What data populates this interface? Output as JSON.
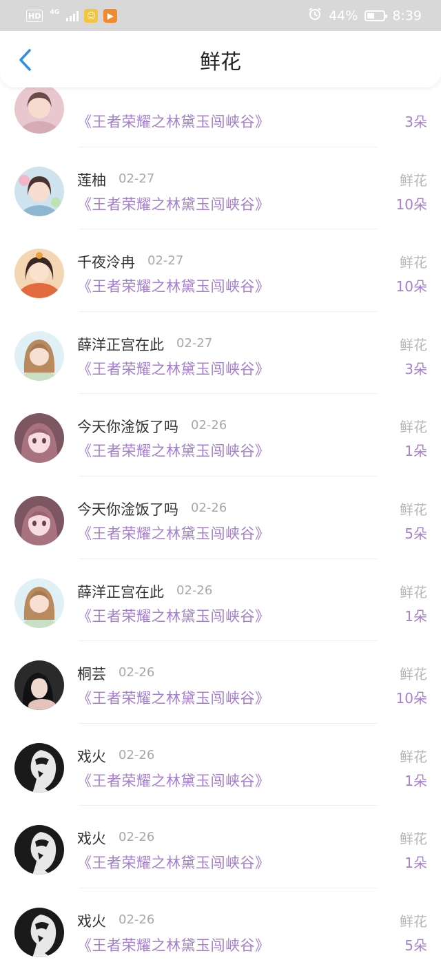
{
  "status_bar": {
    "hd": "HD",
    "network": "4G",
    "battery_percent": "44%",
    "battery_level": 0.44,
    "time": "8:39",
    "icons": [
      "hd-icon",
      "signal-4g-icon",
      "app-notification-icon",
      "video-app-icon",
      "alarm-icon",
      "battery-icon"
    ]
  },
  "header": {
    "title": "鲜花",
    "back_icon": "chevron-left-icon"
  },
  "colors": {
    "accent": "#a57ed0",
    "back": "#2f8fe8",
    "status_bar": "#d8d8d8"
  },
  "rows": [
    {
      "name": "",
      "date": "",
      "book": "《王者荣耀之林黛玉闯峡谷》",
      "gift": "",
      "count": "3朵",
      "avatar": "portrait-pink"
    },
    {
      "name": "莲柚",
      "date": "02-27",
      "book": "《王者荣耀之林黛玉闯峡谷》",
      "gift": "鲜花",
      "count": "10朵",
      "avatar": "portrait-girl"
    },
    {
      "name": "千夜泠冉",
      "date": "02-27",
      "book": "《王者荣耀之林黛玉闯峡谷》",
      "gift": "鲜花",
      "count": "10朵",
      "avatar": "portrait-ancient"
    },
    {
      "name": "薛洋正宫在此",
      "date": "02-27",
      "book": "《王者荣耀之林黛玉闯峡谷》",
      "gift": "鲜花",
      "count": "3朵",
      "avatar": "portrait-blonde"
    },
    {
      "name": "今天你淦饭了吗",
      "date": "02-26",
      "book": "《王者荣耀之林黛玉闯峡谷》",
      "gift": "鲜花",
      "count": "1朵",
      "avatar": "portrait-anime"
    },
    {
      "name": "今天你淦饭了吗",
      "date": "02-26",
      "book": "《王者荣耀之林黛玉闯峡谷》",
      "gift": "鲜花",
      "count": "5朵",
      "avatar": "portrait-anime"
    },
    {
      "name": "薛洋正宫在此",
      "date": "02-26",
      "book": "《王者荣耀之林黛玉闯峡谷》",
      "gift": "鲜花",
      "count": "1朵",
      "avatar": "portrait-blonde"
    },
    {
      "name": "桐芸",
      "date": "02-26",
      "book": "《王者荣耀之林黛玉闯峡谷》",
      "gift": "鲜花",
      "count": "10朵",
      "avatar": "portrait-dark"
    },
    {
      "name": "戏火",
      "date": "02-26",
      "book": "《王者荣耀之林黛玉闯峡谷》",
      "gift": "鲜花",
      "count": "1朵",
      "avatar": "portrait-silhouette"
    },
    {
      "name": "戏火",
      "date": "02-26",
      "book": "《王者荣耀之林黛玉闯峡谷》",
      "gift": "鲜花",
      "count": "1朵",
      "avatar": "portrait-silhouette"
    },
    {
      "name": "戏火",
      "date": "02-26",
      "book": "《王者荣耀之林黛玉闯峡谷》",
      "gift": "鲜花",
      "count": "5朵",
      "avatar": "portrait-silhouette"
    }
  ]
}
